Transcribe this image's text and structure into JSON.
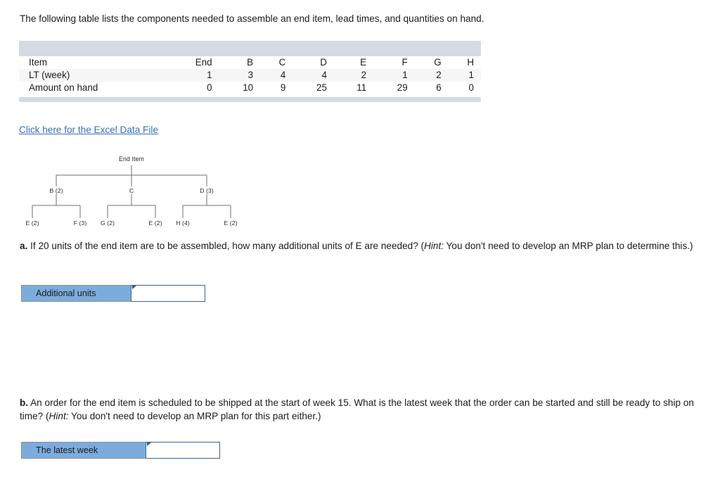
{
  "intro": {
    "text": "The following table lists the components needed to assemble an end item, lead times, and quantities on hand."
  },
  "table": {
    "row_labels": [
      "Item",
      "LT (week)",
      "Amount on hand"
    ],
    "columns": [
      "End",
      "B",
      "C",
      "D",
      "E",
      "F",
      "G",
      "H"
    ],
    "lead_times": [
      "1",
      "3",
      "4",
      "4",
      "2",
      "1",
      "2",
      "1"
    ],
    "amount_on_hand": [
      "0",
      "10",
      "9",
      "25",
      "11",
      "29",
      "6",
      "0"
    ],
    "header_band_color": "#d6dae4",
    "shade_row_color": "#f6f6f7"
  },
  "excel_link": {
    "label": "Click here for the Excel Data File",
    "color": "#3b6fb6"
  },
  "tree": {
    "root": "End Item",
    "level1": [
      "B (2)",
      "C",
      "D (3)"
    ],
    "level2": [
      "E (2)",
      "F (3)",
      "G (2)",
      "E (2)",
      "H (4)",
      "E (2)"
    ],
    "line_color": "#6f6f6f"
  },
  "questions": {
    "a": {
      "lead": "a.",
      "body_1": " If 20 units of the end item are to be assembled, how many additional units of E are needed? (",
      "hint": "Hint:",
      "body_2": " You don't need to develop an MRP plan to determine this.)"
    },
    "b": {
      "lead": "b.",
      "body_1": " An order for the end item is scheduled to be shipped at the start of week 15. What is the latest week that the order can be started and still be ready to ship on time? (",
      "hint": "Hint:",
      "body_2": " You don't need to develop an MRP plan for this part either.)"
    }
  },
  "answers": {
    "a": {
      "label": "Additional units",
      "value": "",
      "placeholder": ""
    },
    "b": {
      "label": "The latest week",
      "value": "",
      "placeholder": ""
    },
    "label_color": "#7cacdd"
  }
}
